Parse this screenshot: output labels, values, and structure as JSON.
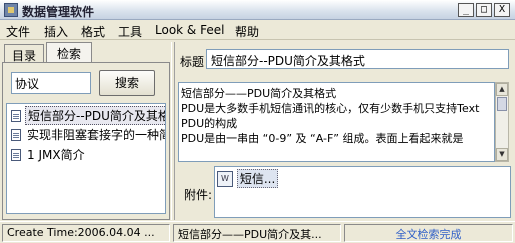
{
  "window": {
    "title": "数据管理软件",
    "controls": [
      "_",
      "□",
      "X"
    ]
  },
  "menu": [
    "文件",
    "插入",
    "格式",
    "工具",
    "Look & Feel",
    "帮助"
  ],
  "left_panel": {
    "tabs": [
      {
        "label": "目录",
        "active": false
      },
      {
        "label": "检索",
        "active": true
      }
    ],
    "search": {
      "value": "协议",
      "button_label": "搜索"
    },
    "results": [
      {
        "label": "短信部分--PDU简介及其格式",
        "selected": true
      },
      {
        "label": "实现非阻塞套接字的一种简单方法",
        "selected": false
      },
      {
        "label": "1 JMX简介",
        "selected": false
      }
    ]
  },
  "right_panel": {
    "title_label": "标题",
    "title_value": "短信部分--PDU简介及其格式",
    "content_lines": [
      "短信部分——PDU简介及其格式",
      "PDU是大多数手机短信通讯的核心，仅有少数手机只支持Text",
      "PDU的构成",
      "PDU是由一串由 “0-9” 及 “A-F” 组成。表面上看起来就是"
    ],
    "attachment_label": "附件:",
    "attachments": [
      {
        "name": "短信...",
        "icon": "document-icon"
      }
    ]
  },
  "status": {
    "create_time": "Create Time:2006.04.04 ...",
    "current_doc": "短信部分——PDU简介及其...",
    "message": "全文检索完成"
  },
  "colors": {
    "window_bg": "#ece9d8",
    "status_message": "#3060c8",
    "field_border": "#7f9db9"
  }
}
